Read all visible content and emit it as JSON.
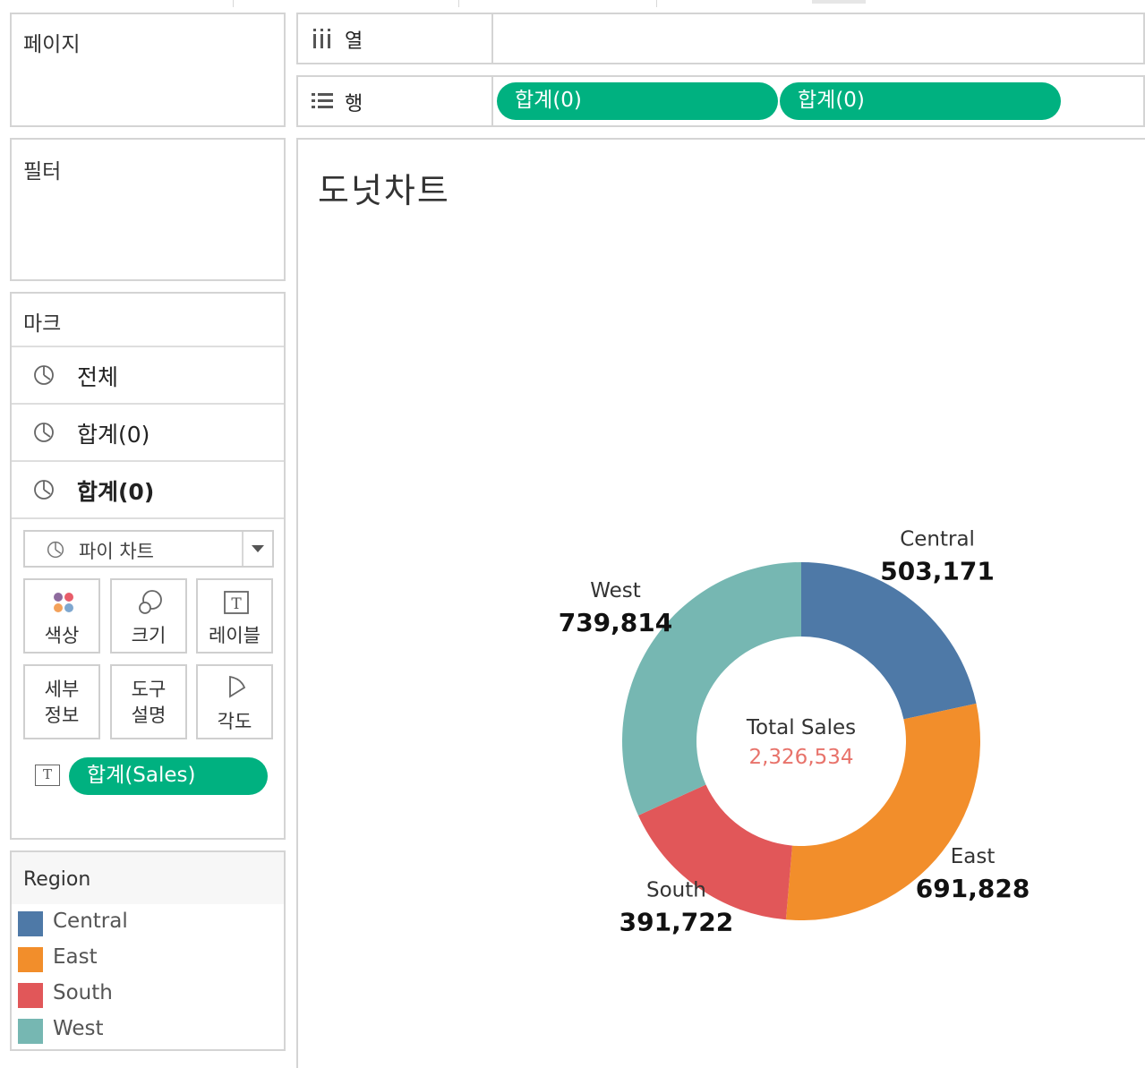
{
  "shelves": {
    "pages_title": "페이지",
    "filters_title": "필터",
    "columns_label": "열",
    "rows_label": "행",
    "rows_pills": [
      "합계(0)",
      "합계(0)"
    ]
  },
  "marks": {
    "title": "마크",
    "rows": [
      "전체",
      "합계(0)",
      "합계(0)"
    ],
    "mark_type": "파이 차트",
    "properties": {
      "color": "색상",
      "size": "크기",
      "label": "레이블",
      "detail_line1": "세부",
      "detail_line2": "정보",
      "tooltip_line1": "도구",
      "tooltip_line2": "설명",
      "angle": "각도"
    },
    "text_field": "합계(Sales)"
  },
  "legend": {
    "title": "Region",
    "items": [
      {
        "label": "Central",
        "color": "#4e79a7"
      },
      {
        "label": "East",
        "color": "#f28e2b"
      },
      {
        "label": "South",
        "color": "#e15759"
      },
      {
        "label": "West",
        "color": "#76b7b2"
      }
    ]
  },
  "view": {
    "title": "도넛차트"
  },
  "chart_data": {
    "type": "pie",
    "title": "도넛차트",
    "center_label": "Total Sales",
    "center_value": "2,326,534",
    "center_value_color": "#e8736b",
    "categories": [
      "Central",
      "East",
      "South",
      "West"
    ],
    "values": [
      503171,
      691828,
      391722,
      739814
    ],
    "value_labels": [
      "503,171",
      "691,828",
      "391,722",
      "739,814"
    ],
    "colors": [
      "#4e79a7",
      "#f28e2b",
      "#e15759",
      "#76b7b2"
    ]
  }
}
